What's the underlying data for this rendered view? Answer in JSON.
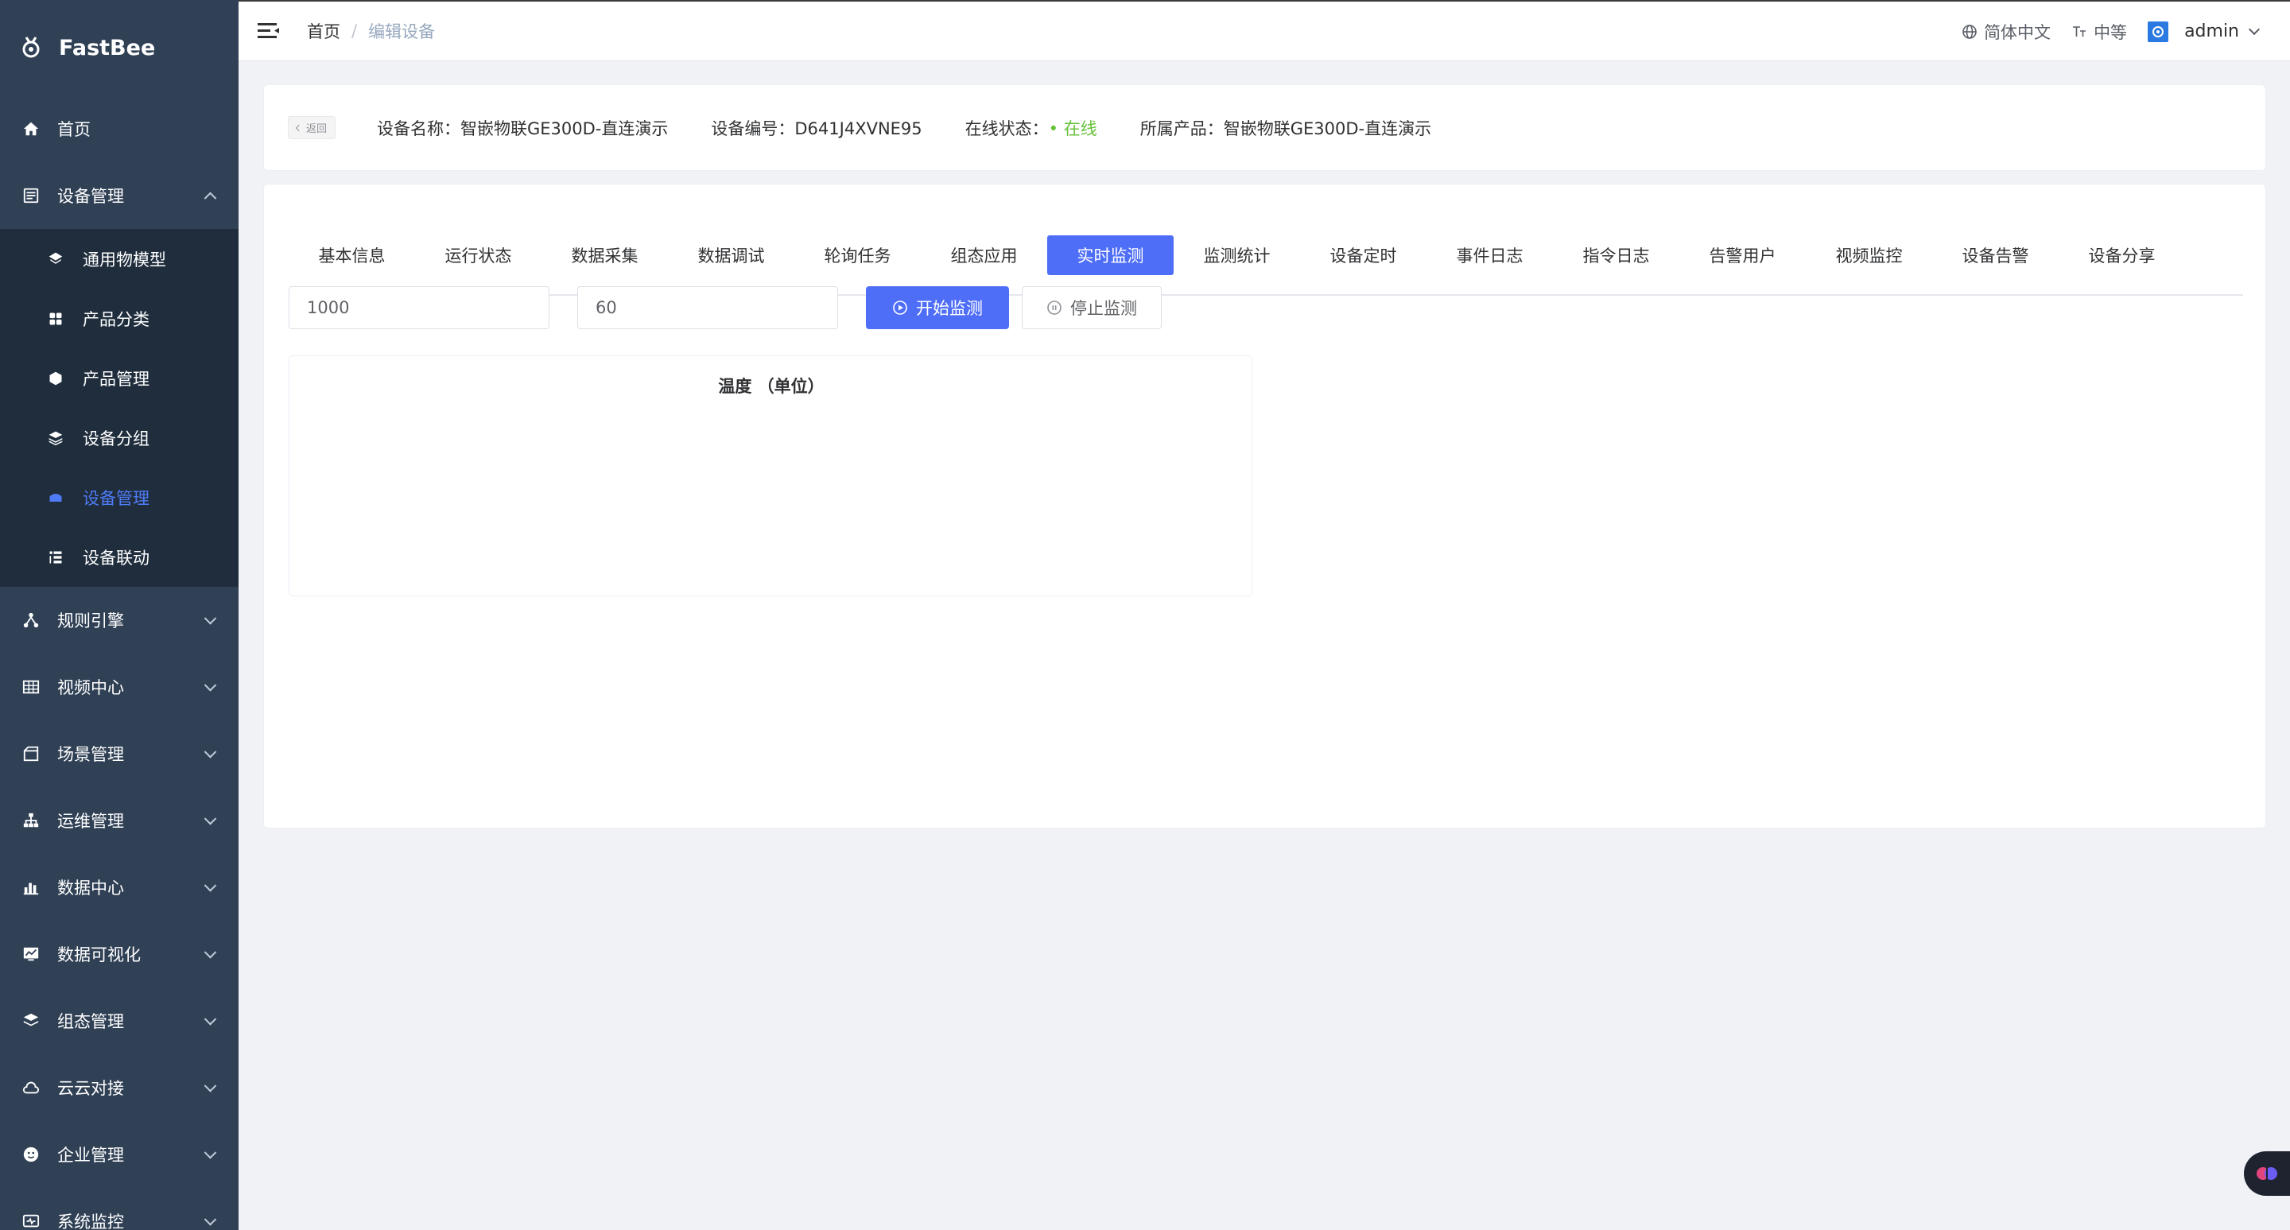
{
  "app": {
    "name": "FastBee"
  },
  "sidebar": {
    "items": [
      {
        "label": "首页",
        "icon": "home-icon"
      },
      {
        "label": "设备管理",
        "icon": "device-icon",
        "expanded": true,
        "children": [
          {
            "label": "通用物模型",
            "icon": "model-icon"
          },
          {
            "label": "产品分类",
            "icon": "category-icon"
          },
          {
            "label": "产品管理",
            "icon": "product-icon"
          },
          {
            "label": "设备分组",
            "icon": "group-icon"
          },
          {
            "label": "设备管理",
            "icon": "device-manage-icon",
            "active": true
          },
          {
            "label": "设备联动",
            "icon": "linkage-icon"
          }
        ]
      },
      {
        "label": "规则引擎",
        "icon": "rule-icon"
      },
      {
        "label": "视频中心",
        "icon": "video-icon"
      },
      {
        "label": "场景管理",
        "icon": "scene-icon"
      },
      {
        "label": "运维管理",
        "icon": "ops-icon"
      },
      {
        "label": "数据中心",
        "icon": "data-icon"
      },
      {
        "label": "数据可视化",
        "icon": "visual-icon"
      },
      {
        "label": "组态管理",
        "icon": "config-icon"
      },
      {
        "label": "云云对接",
        "icon": "cloud-icon"
      },
      {
        "label": "企业管理",
        "icon": "enterprise-icon"
      },
      {
        "label": "系统监控",
        "icon": "monitor-icon"
      }
    ]
  },
  "navbar": {
    "breadcrumb": {
      "home": "首页",
      "separator": "/",
      "current": "编辑设备"
    },
    "language": "简体中文",
    "size": "中等",
    "user": "admin"
  },
  "device_info": {
    "back_label": "返回",
    "name_label": "设备名称：",
    "name_value": "智嵌物联GE300D-直连演示",
    "serial_label": "设备编号：",
    "serial_value": "D641J4XVNE95",
    "status_label": "在线状态：",
    "status_value": "• 在线",
    "product_label": "所属产品：",
    "product_value": "智嵌物联GE300D-直连演示"
  },
  "tabs": [
    {
      "label": "基本信息"
    },
    {
      "label": "运行状态"
    },
    {
      "label": "数据采集"
    },
    {
      "label": "数据调试"
    },
    {
      "label": "轮询任务"
    },
    {
      "label": "组态应用"
    },
    {
      "label": "实时监测",
      "active": true
    },
    {
      "label": "监测统计"
    },
    {
      "label": "设备定时"
    },
    {
      "label": "事件日志"
    },
    {
      "label": "指令日志"
    },
    {
      "label": "告警用户"
    },
    {
      "label": "视频监控"
    },
    {
      "label": "设备告警"
    },
    {
      "label": "设备分享"
    }
  ],
  "monitor": {
    "interval_value": "1000",
    "count_value": "60",
    "start_label": "开始监测",
    "stop_label": "停止监测",
    "chart_title": "温度 （单位）"
  },
  "colors": {
    "sidebar_bg": "#304156",
    "accent": "#4f6ef7",
    "online": "#67c23a"
  }
}
